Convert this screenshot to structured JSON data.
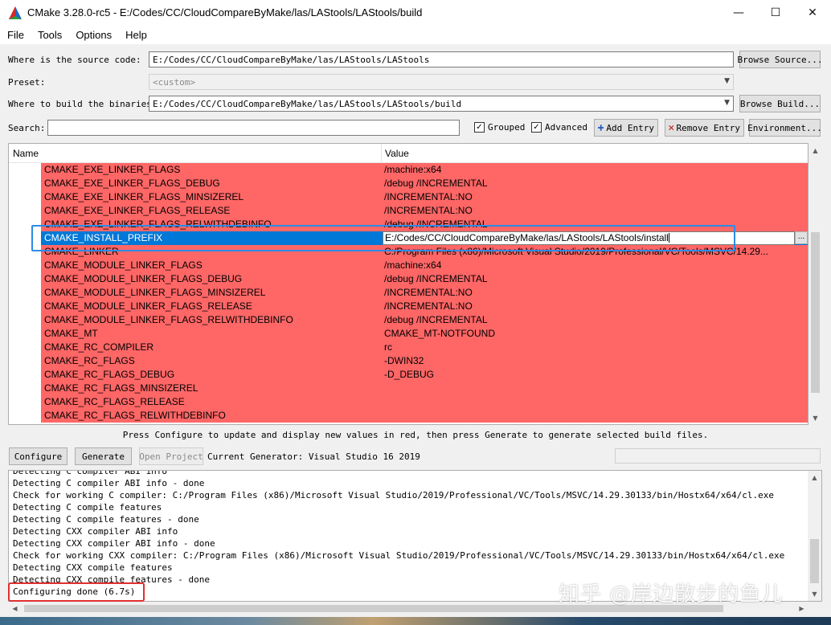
{
  "window": {
    "title": "CMake 3.28.0-rc5 - E:/Codes/CC/CloudCompareByMake/las/LAStools/LAStools/build",
    "minimize": "—",
    "maximize": "☐",
    "close": "✕"
  },
  "menu": [
    "File",
    "Tools",
    "Options",
    "Help"
  ],
  "source": {
    "label": "Where is the source code:",
    "value": "E:/Codes/CC/CloudCompareByMake/las/LAStools/LAStools",
    "button": "Browse Source..."
  },
  "preset": {
    "label": "Preset:",
    "value": "<custom>"
  },
  "build": {
    "label": "Where to build the binaries:",
    "value": "E:/Codes/CC/CloudCompareByMake/las/LAStools/LAStools/build",
    "button": "Browse Build..."
  },
  "search": {
    "label": "Search:",
    "value": ""
  },
  "options": {
    "grouped": {
      "label": "Grouped",
      "checked": true
    },
    "advanced": {
      "label": "Advanced",
      "checked": true
    },
    "add_entry": "Add Entry",
    "remove_entry": "Remove Entry",
    "environment": "Environment..."
  },
  "table": {
    "col_name": "Name",
    "col_value": "Value",
    "highlight_color": "#ff6666",
    "selection_color": "#0078d7",
    "rows": [
      {
        "name": "CMAKE_EXE_LINKER_FLAGS",
        "value": "/machine:x64"
      },
      {
        "name": "CMAKE_EXE_LINKER_FLAGS_DEBUG",
        "value": "/debug /INCREMENTAL"
      },
      {
        "name": "CMAKE_EXE_LINKER_FLAGS_MINSIZEREL",
        "value": "/INCREMENTAL:NO"
      },
      {
        "name": "CMAKE_EXE_LINKER_FLAGS_RELEASE",
        "value": "/INCREMENTAL:NO"
      },
      {
        "name": "CMAKE_EXE_LINKER_FLAGS_RELWITHDEBINFO",
        "value": "/debug /INCREMENTAL"
      },
      {
        "name": "CMAKE_INSTALL_PREFIX",
        "value": "E:/Codes/CC/CloudCompareByMake/las/LAStools/LAStools/install",
        "selected": true
      },
      {
        "name": "CMAKE_LINKER",
        "value": "C:/Program Files (x86)/Microsoft Visual Studio/2019/Professional/VC/Tools/MSVC/14.29..."
      },
      {
        "name": "CMAKE_MODULE_LINKER_FLAGS",
        "value": "/machine:x64"
      },
      {
        "name": "CMAKE_MODULE_LINKER_FLAGS_DEBUG",
        "value": "/debug /INCREMENTAL"
      },
      {
        "name": "CMAKE_MODULE_LINKER_FLAGS_MINSIZEREL",
        "value": "/INCREMENTAL:NO"
      },
      {
        "name": "CMAKE_MODULE_LINKER_FLAGS_RELEASE",
        "value": "/INCREMENTAL:NO"
      },
      {
        "name": "CMAKE_MODULE_LINKER_FLAGS_RELWITHDEBINFO",
        "value": "/debug /INCREMENTAL"
      },
      {
        "name": "CMAKE_MT",
        "value": "CMAKE_MT-NOTFOUND"
      },
      {
        "name": "CMAKE_RC_COMPILER",
        "value": "rc"
      },
      {
        "name": "CMAKE_RC_FLAGS",
        "value": "-DWIN32"
      },
      {
        "name": "CMAKE_RC_FLAGS_DEBUG",
        "value": "-D_DEBUG"
      },
      {
        "name": "CMAKE_RC_FLAGS_MINSIZEREL",
        "value": ""
      },
      {
        "name": "CMAKE_RC_FLAGS_RELEASE",
        "value": ""
      },
      {
        "name": "CMAKE_RC_FLAGS_RELWITHDEBINFO",
        "value": ""
      }
    ]
  },
  "hint": "Press Configure to update and display new values in red, then press Generate to generate selected build files.",
  "actions": {
    "configure": "Configure",
    "generate": "Generate",
    "open_project": "Open Project",
    "generator": "Current Generator: Visual Studio 16 2019"
  },
  "output": {
    "lines": [
      "Detecting C compiler ABI info",
      "Detecting C compiler ABI info - done",
      "Check for working C compiler: C:/Program Files (x86)/Microsoft Visual Studio/2019/Professional/VC/Tools/MSVC/14.29.30133/bin/Hostx64/x64/cl.exe",
      "Detecting C compile features",
      "Detecting C compile features - done",
      "Detecting CXX compiler ABI info",
      "Detecting CXX compiler ABI info - done",
      "Check for working CXX compiler: C:/Program Files (x86)/Microsoft Visual Studio/2019/Professional/VC/Tools/MSVC/14.29.30133/bin/Hostx64/x64/cl.exe",
      "Detecting CXX compile features",
      "Detecting CXX compile features - done",
      "Configuring done (6.7s)"
    ]
  },
  "watermark": "知乎 @岸边散步的鱼儿"
}
